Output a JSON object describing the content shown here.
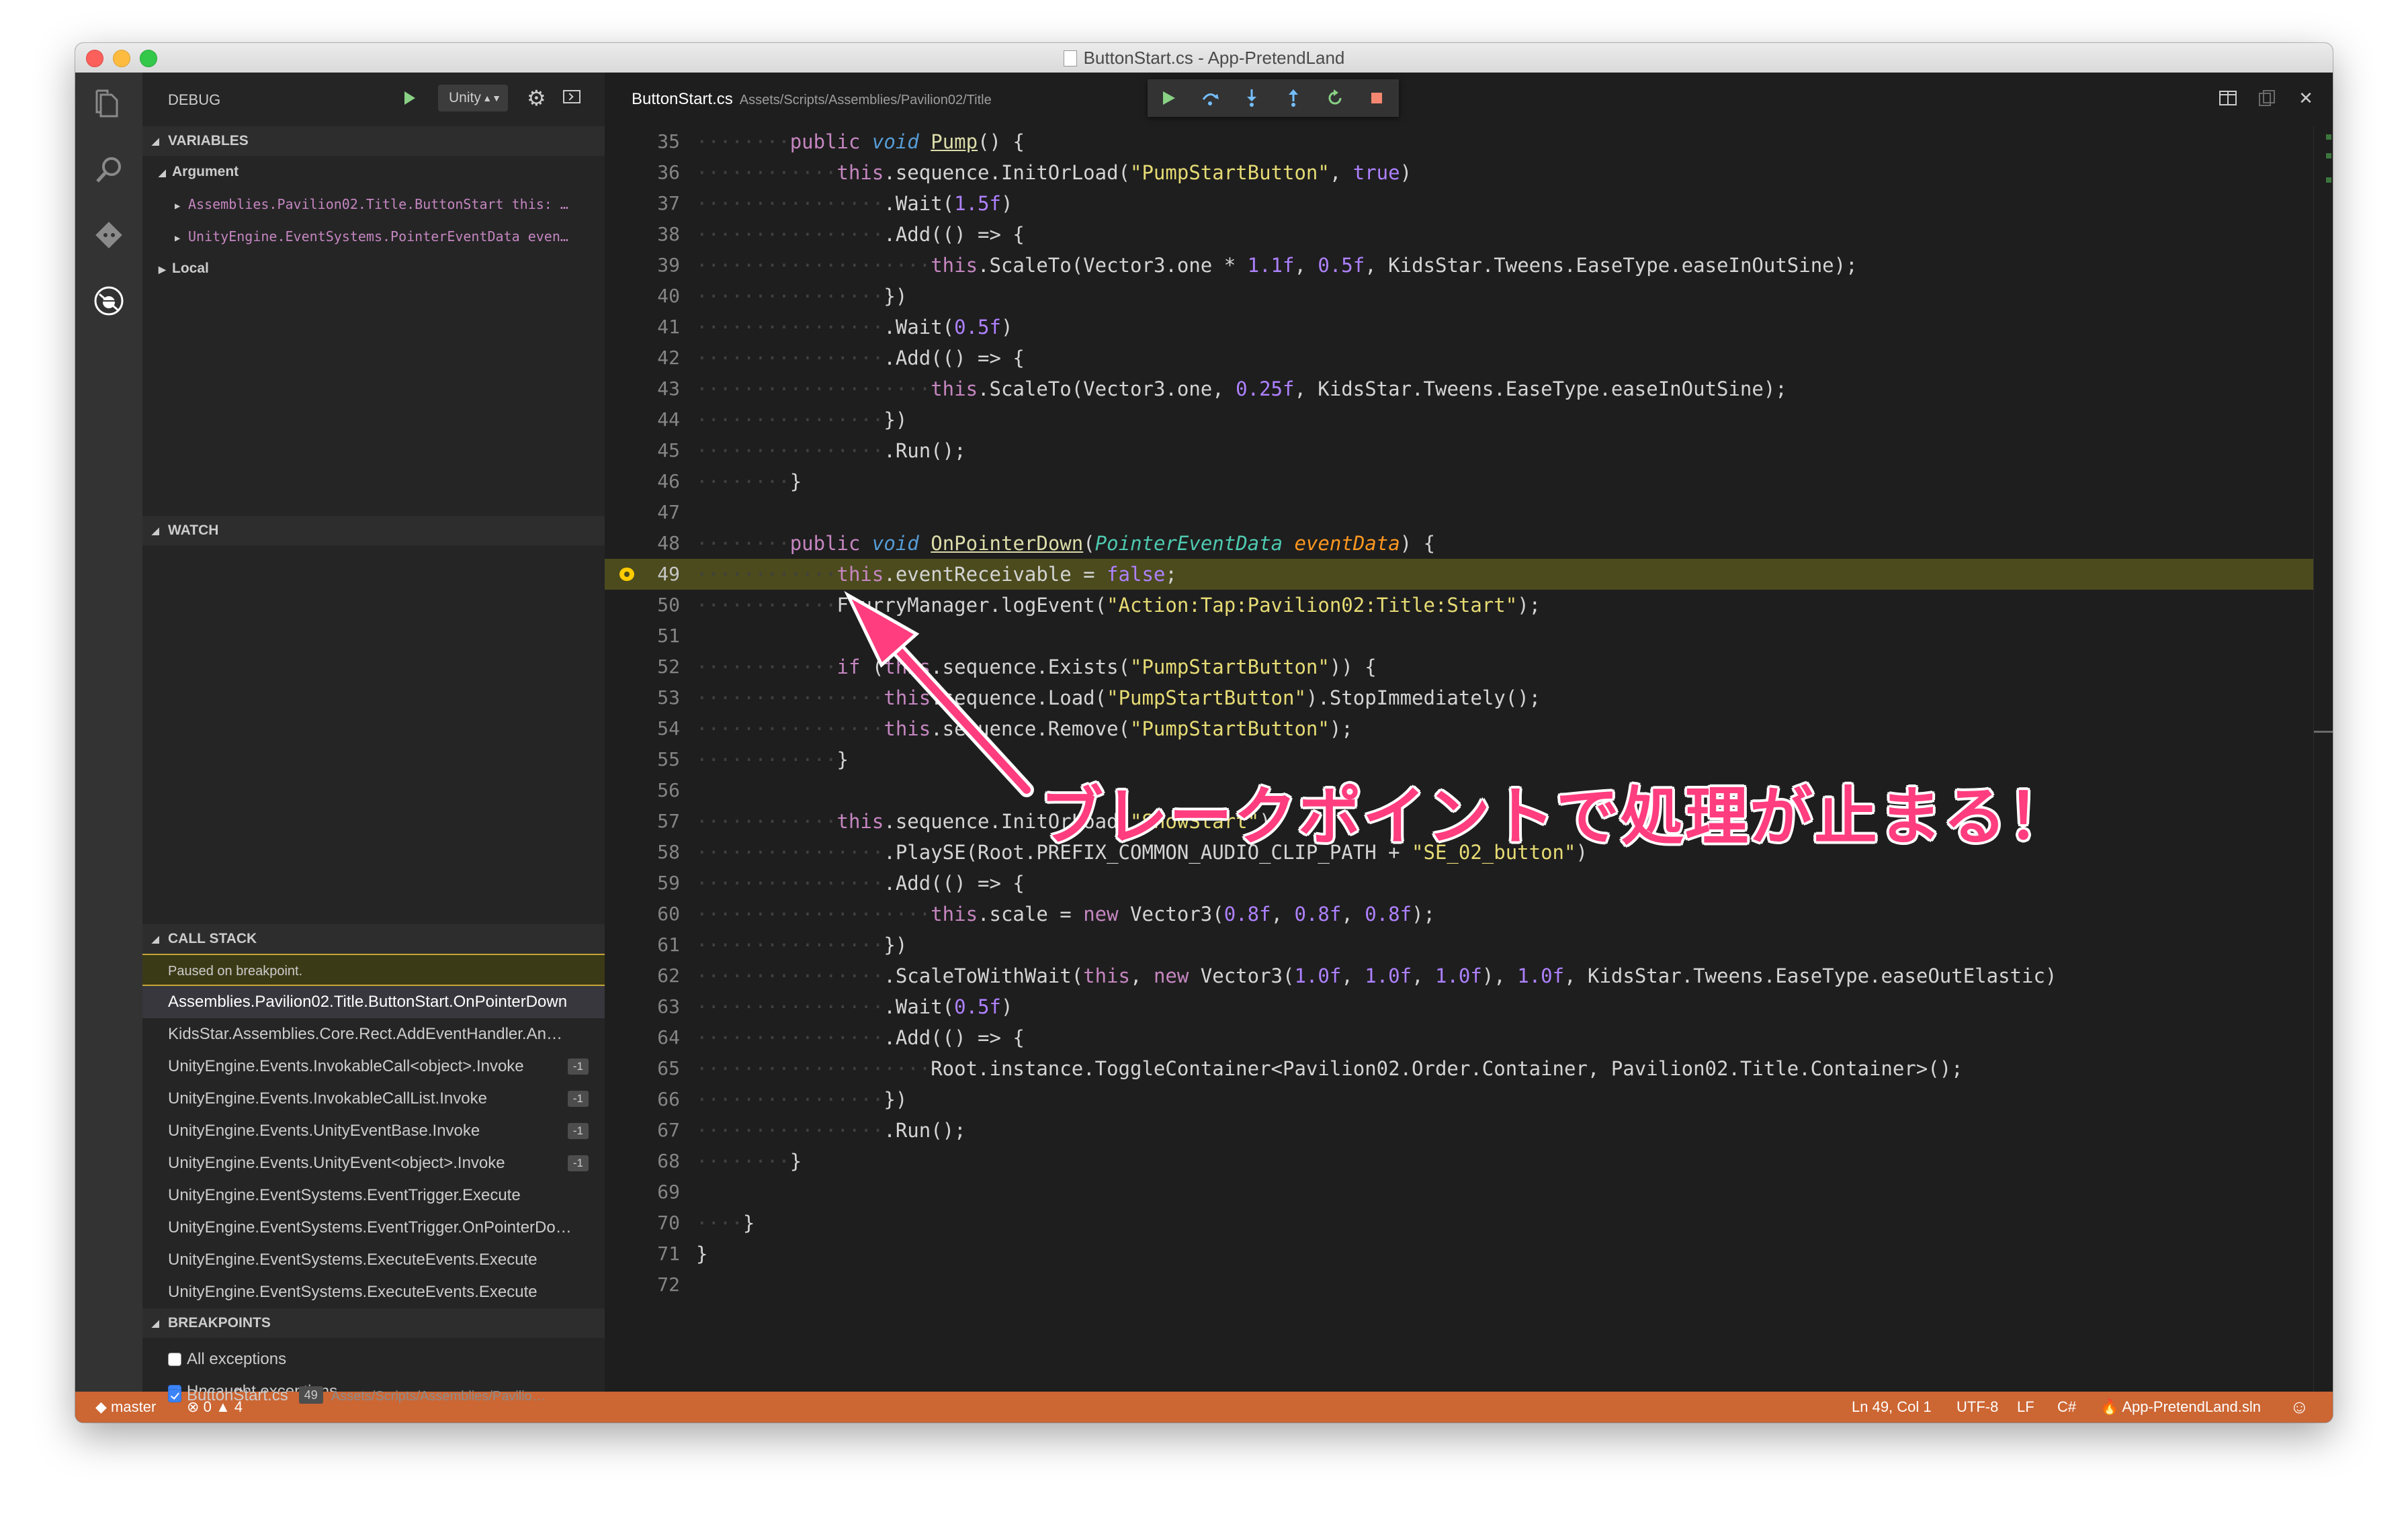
{
  "window": {
    "title": "ButtonStart.cs - App-PretendLand"
  },
  "debug": {
    "title": "DEBUG",
    "configuration": "Unity",
    "variables_title": "VARIABLES",
    "argument_label": "Argument",
    "argument_items": [
      "Assemblies.Pavilion02.Title.ButtonStart this: …",
      "UnityEngine.EventSystems.PointerEventData even…"
    ],
    "local_label": "Local",
    "watch_title": "WATCH",
    "callstack_title": "CALL STACK",
    "paused_text": "Paused on breakpoint.",
    "callstack": [
      {
        "name": "Assemblies.Pavilion02.Title.ButtonStart.OnPointerDown",
        "badge": ""
      },
      {
        "name": "KidsStar.Assemblies.Core.Rect.AddEventHandler.An…",
        "badge": ""
      },
      {
        "name": "UnityEngine.Events.InvokableCall<object>.Invoke",
        "badge": "-1"
      },
      {
        "name": "UnityEngine.Events.InvokableCallList.Invoke",
        "badge": "-1"
      },
      {
        "name": "UnityEngine.Events.UnityEventBase.Invoke",
        "badge": "-1"
      },
      {
        "name": "UnityEngine.Events.UnityEvent<object>.Invoke",
        "badge": "-1"
      },
      {
        "name": "UnityEngine.EventSystems.EventTrigger.Execute",
        "badge": ""
      },
      {
        "name": "UnityEngine.EventSystems.EventTrigger.OnPointerDo…",
        "badge": ""
      },
      {
        "name": "UnityEngine.EventSystems.ExecuteEvents.Execute",
        "badge": ""
      },
      {
        "name": "UnityEngine.EventSystems.ExecuteEvents.Execute",
        "badge": ""
      }
    ],
    "breakpoints_title": "BREAKPOINTS",
    "breakpoints": {
      "all_exceptions": "All exceptions",
      "uncaught_exceptions": "Uncaught exceptions",
      "file": "ButtonStart.cs",
      "line": "49",
      "path": "Assets/Scripts/Assemblies/Pavilio…"
    }
  },
  "editor": {
    "tab_file": "ButtonStart.cs",
    "tab_path": "Assets/Scripts/Assemblies/Pavilion02/Title",
    "line_numbers": [
      "35",
      "36",
      "37",
      "38",
      "39",
      "40",
      "41",
      "42",
      "43",
      "44",
      "45",
      "46",
      "47",
      "48",
      "49",
      "50",
      "51",
      "52",
      "53",
      "54",
      "55",
      "56",
      "57",
      "58",
      "59",
      "60",
      "61",
      "62",
      "63",
      "64",
      "65",
      "66",
      "67",
      "68",
      "69",
      "70",
      "71",
      "72"
    ],
    "current_line": "49"
  },
  "status": {
    "branch": "master",
    "errors": "0",
    "warnings": "4",
    "position": "Ln 49, Col 1",
    "encoding": "UTF-8",
    "eol": "LF",
    "language": "C#",
    "solution": "App-PretendLand.sln"
  },
  "annotation": {
    "text": "ブレークポイントで処理が止まる！"
  },
  "colors": {
    "status_bar": "#cc6633",
    "annotation": "#ff3d7f",
    "current_line": "#4b4b1e"
  }
}
